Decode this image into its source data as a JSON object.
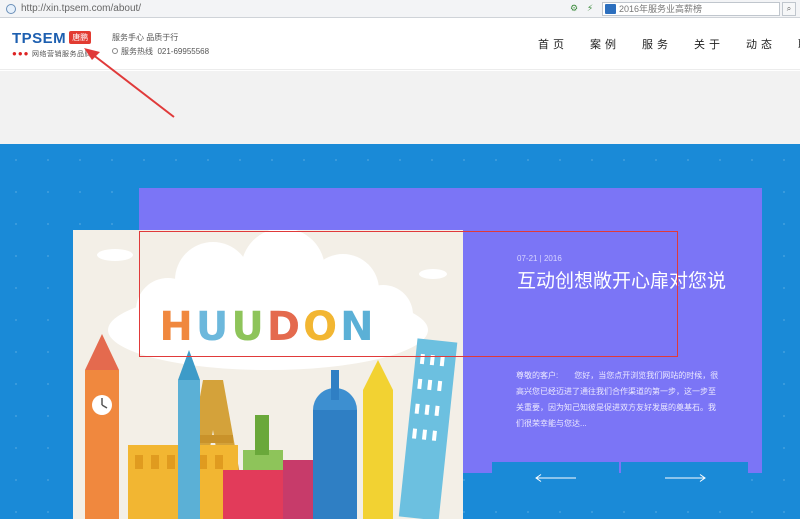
{
  "browser": {
    "url": "http://xin.tpsem.com/about/",
    "search_text": "2016年服务业高薪榜"
  },
  "header": {
    "logo_text": "TPSEM",
    "logo_badge": "唐鹏",
    "logo_tagline": "网络营销服务品牌",
    "service_links": "服务手心    品质于行",
    "hotline_label": "服务热线",
    "hotline_number": "021-69955568",
    "nav": [
      "首页",
      "案例",
      "服务",
      "关于",
      "动态",
      "联系"
    ]
  },
  "article": {
    "date": "07-21 | 2016",
    "title": "互动创想敞开心扉对您说",
    "body": "尊敬的客户:　　您好，当您点开浏览我们网站的时候，很高兴您已经迈进了通往我们合作渠道的第一步，这一步至关重要，因为知己知彼是促进双方友好发展的奠基石。我们很荣幸能与您达...",
    "illustration_word": "HUUDON",
    "illustration_letter_colors": [
      "#f0883e",
      "#6cb8dc",
      "#8ec45a",
      "#e46a4e",
      "#f2b632",
      "#5bb0d6"
    ]
  },
  "colors": {
    "brand_blue": "#1d5fb0",
    "section_blue": "#1a8ad7",
    "card_purple": "#7b75f6",
    "annotation_red": "#e03a3a"
  }
}
